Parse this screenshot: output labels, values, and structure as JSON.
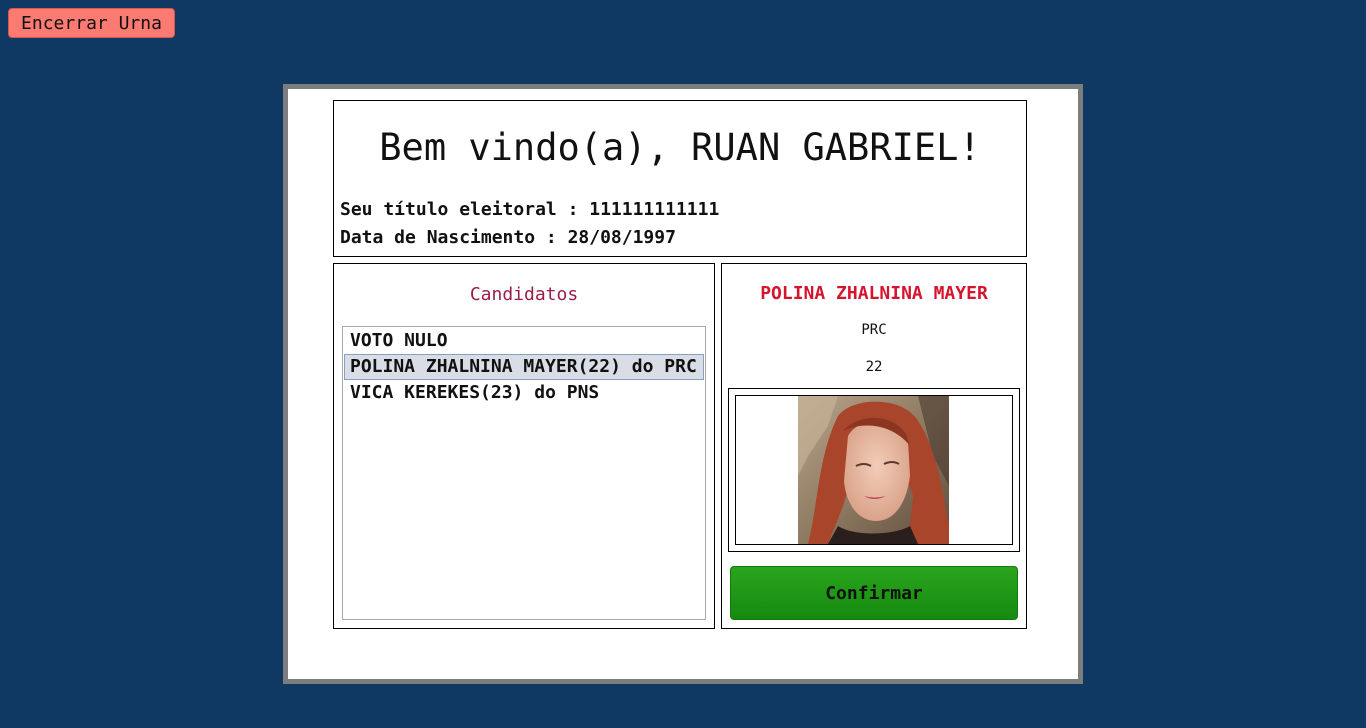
{
  "toolbar": {
    "end_label": "Encerrar Urna"
  },
  "welcome": {
    "title": "Bem vindo(a), RUAN GABRIEL!",
    "voter_id_line": "Seu título eleitoral : 111111111111",
    "birth_line": "Data de Nascimento : 28/08/1997"
  },
  "candidates": {
    "title": "Candidatos",
    "items": [
      {
        "label": "VOTO NULO",
        "selected": false
      },
      {
        "label": "POLINA ZHALNINA MAYER(22) do PRC",
        "selected": true
      },
      {
        "label": "VICA KEREKES(23) do PNS",
        "selected": false
      }
    ]
  },
  "selected_candidate": {
    "name": "POLINA ZHALNINA MAYER",
    "party": "PRC",
    "number": "22",
    "photo_icon": "candidate-photo"
  },
  "confirm_label": "Confirmar",
  "colors": {
    "background": "#0f3862",
    "end_button": "#fb7a72",
    "candidates_title": "#9b1d48",
    "candidate_name": "#d6142e",
    "confirm_button": "#1f9a16"
  }
}
